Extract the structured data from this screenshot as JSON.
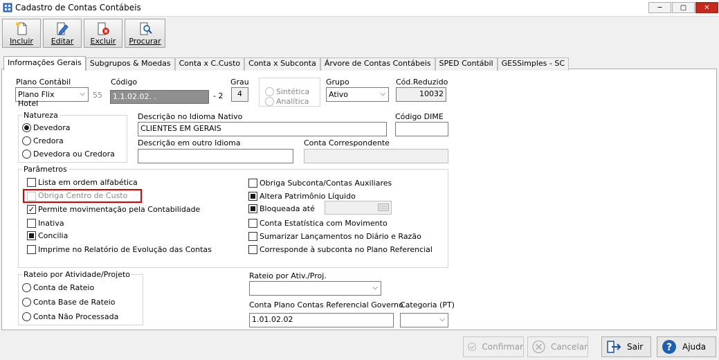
{
  "window": {
    "title": "Cadastro de Contas Contábeis",
    "minimize": "─",
    "maximize": "▢",
    "close": "✕"
  },
  "toolbar": {
    "incluir": "Incluir",
    "editar": "Editar",
    "excluir": "Excluir",
    "procurar": "Procurar"
  },
  "tabs": [
    {
      "label": "Informações Gerais"
    },
    {
      "label": "Subgrupos & Moedas"
    },
    {
      "label": "Conta x C.Custo"
    },
    {
      "label": "Conta x Subconta"
    },
    {
      "label": "Árvore de Contas Contábeis"
    },
    {
      "label": "SPED Contábil"
    },
    {
      "label": "GESSimples - SC"
    }
  ],
  "form": {
    "plano_label": "Plano Contábil",
    "plano_value": "Plano Flix Hotel",
    "plano_num": "55",
    "codigo_label": "Código",
    "codigo_value": "1.1.02.02.   .",
    "codigo_suffix": "- 2",
    "grau_label": "Grau",
    "grau_value": "4",
    "sintetica": "Sintética",
    "analitica": "Analítica",
    "grupo_label": "Grupo",
    "grupo_value": "Ativo",
    "cod_reduzido_label": "Cód.Reduzido",
    "cod_reduzido_value": "10032",
    "natureza_title": "Natureza",
    "devedora": "Devedora",
    "credora": "Credora",
    "devedora_credora": "Devedora ou Credora",
    "desc_nativo_label": "Descrição no Idioma Nativo",
    "desc_nativo_value": "CLIENTES EM GERAIS",
    "codigo_dime_label": "Código DIME",
    "codigo_dime_value": "",
    "desc_outro_label": "Descrição em outro Idioma",
    "desc_outro_value": "",
    "conta_corresp_label": "Conta Correspondente",
    "conta_corresp_value": "",
    "parametros_title": "Parâmetros",
    "params_left": [
      {
        "label": "Lista em ordem alfabética",
        "state": "unchecked"
      },
      {
        "label": "Obriga Centro de Custo",
        "state": "disabled"
      },
      {
        "label": "Permite movimentação pela Contabilidade",
        "state": "checked"
      },
      {
        "label": "Inativa",
        "state": "unchecked"
      },
      {
        "label": "Concilia",
        "state": "filled"
      },
      {
        "label": "Imprime no Relatório de Evolução das Contas",
        "state": "unchecked"
      }
    ],
    "params_right": [
      {
        "label": "Obriga Subconta/Contas Auxiliares",
        "state": "unchecked"
      },
      {
        "label": "Altera Patrimônio Líquido",
        "state": "filled"
      },
      {
        "label": "Bloqueada até",
        "state": "filled"
      },
      {
        "label": "Conta Estatística com Movimento",
        "state": "unchecked"
      },
      {
        "label": "Sumarizar Lançamentos no Diário e Razão",
        "state": "unchecked"
      },
      {
        "label": "Corresponde à subconta no Plano Referencial",
        "state": "unchecked"
      }
    ],
    "rateio_title": "Rateio por Atividade/Projeto",
    "conta_rateio": "Conta de Rateio",
    "conta_base_rateio": "Conta Base de Rateio",
    "conta_nao_processada": "Conta Não Processada",
    "rateio_ativ_label": "Rateio por Ativ./Proj.",
    "rateio_ativ_value": "",
    "conta_ref_label": "Conta Plano Contas Referencial Governo",
    "conta_ref_value": "1.01.02.02",
    "categoria_label": "Categoria (PT)",
    "categoria_value": ""
  },
  "buttons": {
    "confirmar": "Confirmar",
    "cancelar": "Cancelar",
    "sair": "Sair",
    "ajuda": "Ajuda"
  }
}
